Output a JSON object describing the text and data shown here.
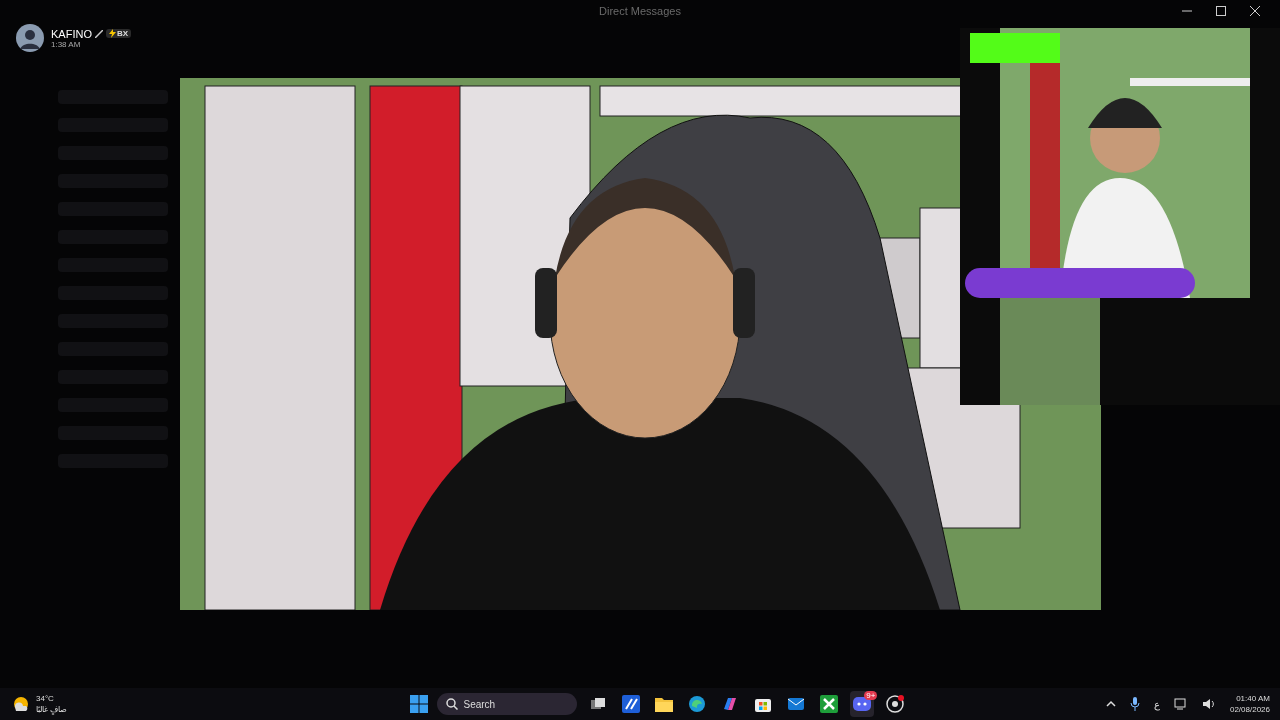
{
  "window": {
    "title": "Direct Messages"
  },
  "viewer_header": {
    "name": "KAFINO",
    "badge": "BX",
    "time": "1:38 AM"
  },
  "viewer": {
    "kind": "picture"
  },
  "taskbar": {
    "weather": {
      "temp": "34°C",
      "condition": "صافٍ غالبًا"
    },
    "search": {
      "placeholder": "Search"
    },
    "apps": [
      {
        "kind": "task-view",
        "selected": false
      },
      {
        "kind": "editor",
        "selected": false
      },
      {
        "kind": "folder",
        "selected": false
      },
      {
        "kind": "browser",
        "selected": false
      },
      {
        "kind": "copilot",
        "selected": false
      },
      {
        "kind": "store",
        "selected": false
      },
      {
        "kind": "mail",
        "selected": false
      },
      {
        "kind": "xbox",
        "selected": false
      },
      {
        "kind": "chat",
        "selected": true,
        "badge": "9+"
      },
      {
        "kind": "recorder",
        "selected": false
      }
    ],
    "language": "ع",
    "time": "01:40 AM",
    "date": "02/08/2026"
  }
}
